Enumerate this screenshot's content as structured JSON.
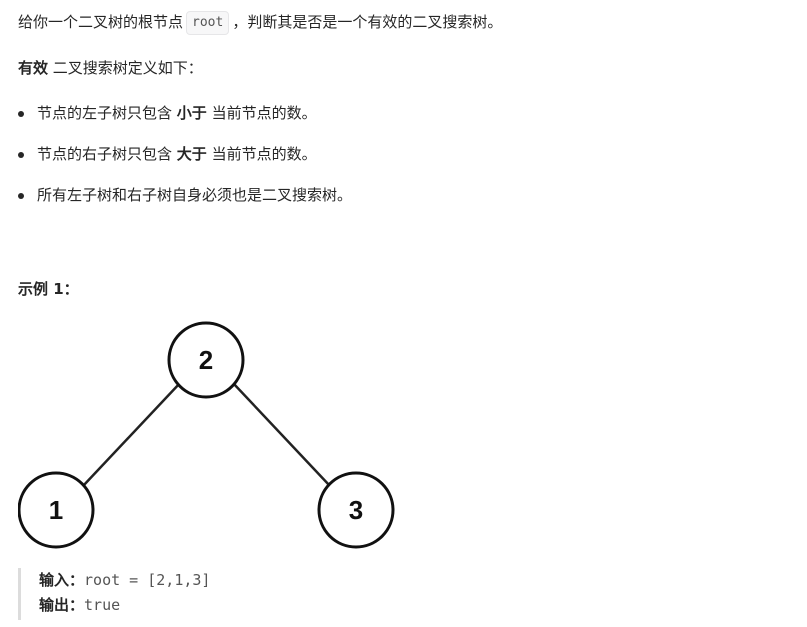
{
  "intro": {
    "before": "给你一个二叉树的根节点",
    "code": "root",
    "after": "，判断其是否是一个有效的二叉搜索树。"
  },
  "definition": {
    "bold": "有效",
    "text": " 二叉搜索树定义如下："
  },
  "rules": [
    {
      "before": "节点的左子树只包含 ",
      "bold": "小于",
      "after": " 当前节点的数。"
    },
    {
      "before": "节点的右子树只包含 ",
      "bold": "大于",
      "after": " 当前节点的数。"
    },
    {
      "before": "所有左子树和右子树自身必须也是二叉搜索树。",
      "bold": "",
      "after": ""
    }
  ],
  "example": {
    "title": "示例 1：",
    "tree": {
      "root": "2",
      "left": "1",
      "right": "3"
    },
    "input_label": "输入：",
    "input_value": "root = [2,1,3]",
    "output_label": "输出：",
    "output_value": "true"
  }
}
